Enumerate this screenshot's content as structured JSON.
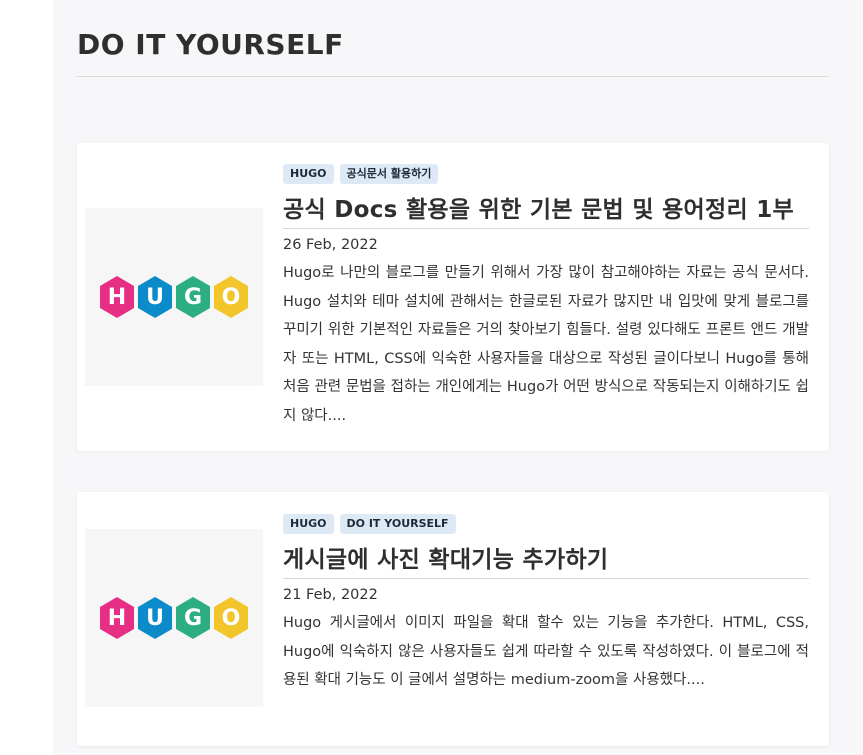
{
  "section": {
    "heading": "DO IT YOURSELF"
  },
  "logo": {
    "letters": [
      "H",
      "U",
      "G",
      "O"
    ],
    "colors": [
      "#e62f84",
      "#0b8bca",
      "#2dae82",
      "#f2c52a"
    ]
  },
  "posts": [
    {
      "tags": [
        "HUGO",
        "공식문서 활용하기"
      ],
      "title": "공식 Docs 활용을 위한 기본 문법 및 용어정리 1부",
      "date": "26 Feb, 2022",
      "excerpt": "Hugo로 나만의 블로그를 만들기 위해서 가장 많이 참고해야하는 자료는 공식 문서다. Hugo 설치와 테마 설치에 관해서는 한글로된 자료가 많지만 내 입맛에 맞게 블로그를 꾸미기 위한 기본적인 자료들은 거의 찾아보기 힘들다. 설령 있다해도 프론트 앤드 개발자 또는 HTML, CSS에 익숙한 사용자들을 대상으로 작성된 글이다보니 Hugo를 통해 처음 관련 문법을 접하는 개인에게는 Hugo가 어떤 방식으로 작동되는지 이해하기도 쉽지 않다...."
    },
    {
      "tags": [
        "HUGO",
        "DO IT YOURSELF"
      ],
      "title": "게시글에 사진 확대기능 추가하기",
      "date": "21 Feb, 2022",
      "excerpt": "Hugo 게시글에서 이미지 파일을 확대 할수 있는 기능을 추가한다. HTML, CSS, Hugo에 익숙하지 않은 사용자들도 쉽게 따라할 수 있도록 작성하였다. 이 블로그에 적용된 확대 기능도 이 글에서 설명하는 medium-zoom을 사용했다...."
    }
  ]
}
